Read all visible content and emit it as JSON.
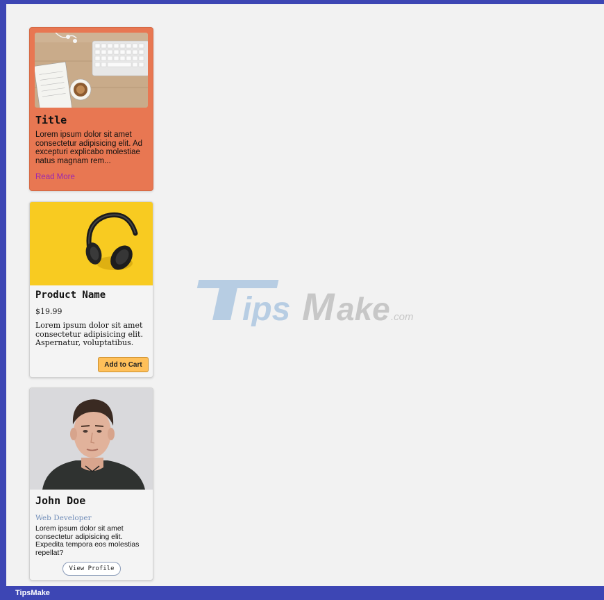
{
  "colors": {
    "frame": "#3d46b4",
    "card1_bg": "#e87752",
    "cart_button": "#ffc05a",
    "link": "#9c27b0"
  },
  "card1": {
    "image": "desk-workspace-photo",
    "title": "Title",
    "description": "Lorem ipsum dolor sit amet consectetur adipisicing elit. Ad excepturi explicabo molestiae natus magnam rem...",
    "link_label": "Read More"
  },
  "card2": {
    "image": "headphones-photo",
    "title": "Product Name",
    "price": "$19.99",
    "description": "Lorem ipsum dolor sit amet consectetur adipisicing elit. Aspernatur, voluptatibus.",
    "button_label": "Add to Cart"
  },
  "card3": {
    "image": "person-portrait-photo",
    "name": "John Doe",
    "role": "Web Developer",
    "description": "Lorem ipsum dolor sit amet consectetur adipisicing elit. Expedita tempora eos molestias repellat?",
    "button_label": "View Profile"
  },
  "watermark": {
    "main": "TipsMake",
    "suffix": ".com"
  },
  "footer": {
    "label": "TipsMake"
  }
}
